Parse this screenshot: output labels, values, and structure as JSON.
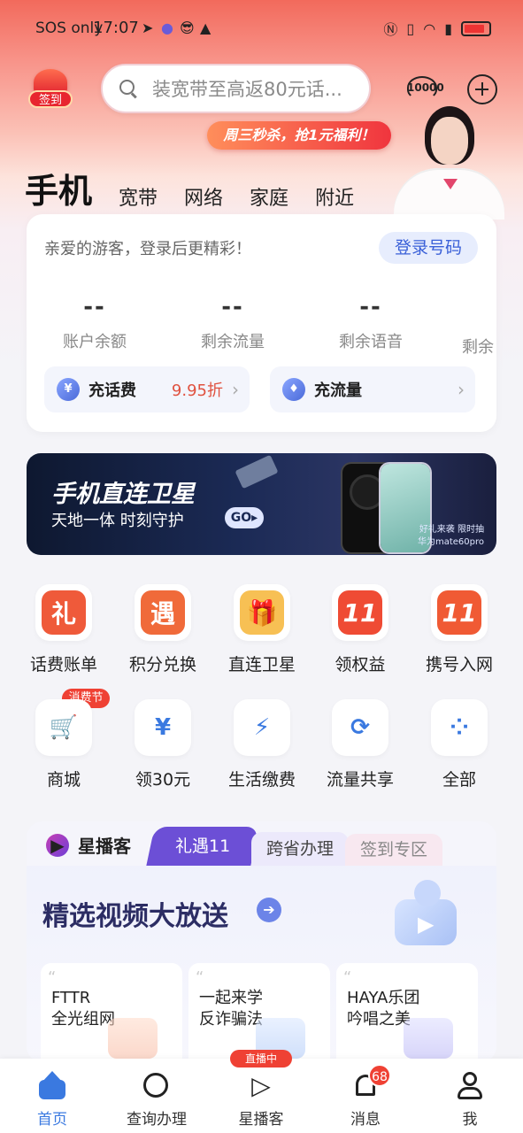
{
  "status_bar": {
    "carrier": "SOS only",
    "time": "17:07"
  },
  "header": {
    "checkin_label": "签到",
    "search_placeholder": "装宽带至高返80元话...",
    "hotline": "10000",
    "promo": "周三秒杀，抢1元福利！"
  },
  "tabs": {
    "main": "手机",
    "others": [
      "宽带",
      "网络",
      "家庭",
      "附近"
    ]
  },
  "account": {
    "welcome": "亲爱的游客，登录后更精彩！",
    "login_button": "登录号码",
    "stats": [
      {
        "value": "--",
        "label": "账户余额"
      },
      {
        "value": "--",
        "label": "剩余流量"
      },
      {
        "value": "--",
        "label": "剩余语音"
      },
      {
        "value": "",
        "label": "剩余"
      }
    ],
    "recharge_fee": {
      "label": "充话费",
      "discount": "9.95折"
    },
    "recharge_data": {
      "label": "充流量"
    }
  },
  "banner": {
    "title": "手机直连卫星",
    "subtitle": "天地一体 时刻守护",
    "go": "GO▸",
    "caption1": "好礼来袭 限时抽",
    "caption2": "华为mate60pro"
  },
  "grid": {
    "row1": [
      {
        "label": "话费账单",
        "glyph": "礼",
        "color": "#ef5a3a"
      },
      {
        "label": "积分兑换",
        "glyph": "遇",
        "color": "#f06a3a"
      },
      {
        "label": "直连卫星",
        "glyph": "🎁",
        "color": "#f5a23a"
      },
      {
        "label": "领权益",
        "glyph": "11",
        "color": "#ef4b34"
      },
      {
        "label": "携号入网",
        "glyph": "11",
        "color": "#f05a34"
      }
    ],
    "row2": [
      {
        "label": "商城",
        "glyph": "🛒"
      },
      {
        "label": "领30元",
        "glyph": "¥"
      },
      {
        "label": "生活缴费",
        "glyph": "⚡"
      },
      {
        "label": "流量共享",
        "glyph": "⟳"
      },
      {
        "label": "全部",
        "glyph": "⁘"
      }
    ],
    "hot_tag": "消费节"
  },
  "live": {
    "title": "星播客",
    "tabs": [
      "礼遇11",
      "跨省办理",
      "签到专区"
    ],
    "headline": "精选视频大放送",
    "cards": [
      {
        "line1": "FTTR",
        "line2": "全光组网"
      },
      {
        "line1": "一起来学",
        "line2": "反诈骗法"
      },
      {
        "line1": "HAYA乐团",
        "line2": "吟唱之美"
      }
    ]
  },
  "nav": {
    "items": [
      "首页",
      "查询办理",
      "星播客",
      "消息",
      "我"
    ],
    "live_badge": "直播中",
    "msg_badge": "68"
  },
  "colors": {
    "accent": "#3a79e0",
    "red": "#ef4134",
    "banner": "#1b2a55"
  }
}
